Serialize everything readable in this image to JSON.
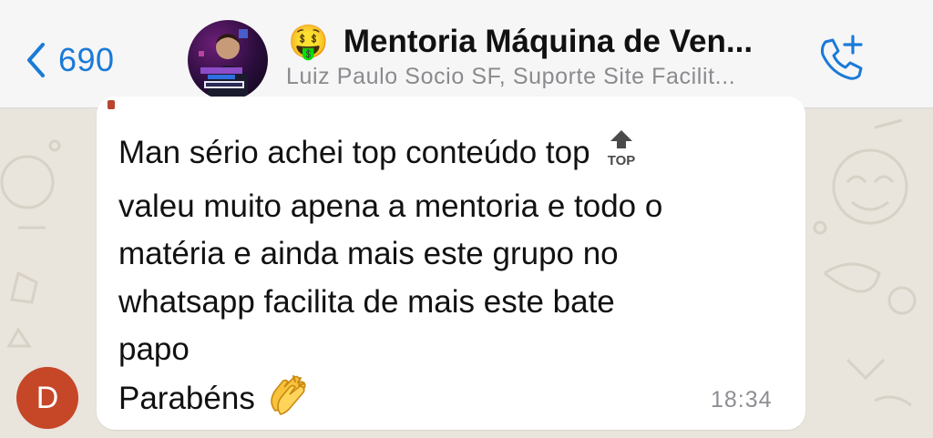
{
  "header": {
    "back_count": "690",
    "title_emoji": "🤑",
    "title": "Mentoria Máquina de Ven...",
    "subtitle": "Luiz Paulo Socio SF, Suporte Site Facilit...",
    "avatar_icon": "group-avatar-image",
    "call_icon": "add-call-icon"
  },
  "message": {
    "lines": [
      "Man sério achei top conteúdo top",
      "valeu muito apena a mentoria e todo o",
      "matéria e ainda mais este grupo no",
      "whatsapp facilita de mais este bate",
      "papo",
      "Parabéns"
    ],
    "top_emoji_label": "TOP",
    "clap_emoji": "clapping-hands-icon",
    "time": "18:34",
    "sender_initial": "D"
  },
  "colors": {
    "accent": "#1a7ad8",
    "sender_avatar": "#c64628",
    "bubble": "#ffffff",
    "wallpaper": "#e9e4dc"
  }
}
